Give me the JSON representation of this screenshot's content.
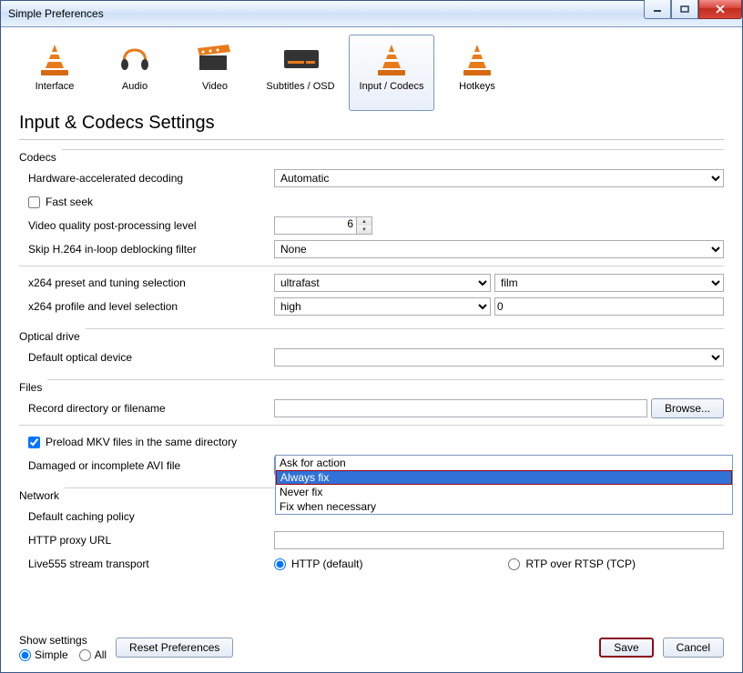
{
  "window": {
    "title": "Simple Preferences"
  },
  "tabs": {
    "interface": "Interface",
    "audio": "Audio",
    "video": "Video",
    "subtitles": "Subtitles / OSD",
    "input_codecs": "Input / Codecs",
    "hotkeys": "Hotkeys"
  },
  "heading": "Input & Codecs Settings",
  "groups": {
    "codecs": "Codecs",
    "optical": "Optical drive",
    "files": "Files",
    "network": "Network"
  },
  "codecs": {
    "hw_decode_label": "Hardware-accelerated decoding",
    "hw_decode_value": "Automatic",
    "fast_seek_label": "Fast seek",
    "pp_level_label": "Video quality post-processing level",
    "pp_level_value": "6",
    "skip_loop_label": "Skip H.264 in-loop deblocking filter",
    "skip_loop_value": "None",
    "x264_preset_label": "x264 preset and tuning selection",
    "x264_preset_value": "ultrafast",
    "x264_tune_value": "film",
    "x264_profile_label": "x264 profile and level selection",
    "x264_profile_value": "high",
    "x264_level_value": "0"
  },
  "optical": {
    "default_device_label": "Default optical device",
    "default_device_value": ""
  },
  "files": {
    "record_label": "Record directory or filename",
    "record_value": "",
    "browse": "Browse...",
    "preload_mkv_label": "Preload MKV files in the same directory",
    "avi_label": "Damaged or incomplete AVI file",
    "avi_value": "Ask for action",
    "avi_options": [
      "Ask for action",
      "Always fix",
      "Never fix",
      "Fix when necessary"
    ]
  },
  "network": {
    "caching_label": "Default caching policy",
    "proxy_label": "HTTP proxy URL",
    "proxy_value": "",
    "live555_label": "Live555 stream transport",
    "live555_http": "HTTP (default)",
    "live555_rtp": "RTP over RTSP (TCP)"
  },
  "footer": {
    "show_settings": "Show settings",
    "simple": "Simple",
    "all": "All",
    "reset": "Reset Preferences",
    "save": "Save",
    "cancel": "Cancel"
  }
}
